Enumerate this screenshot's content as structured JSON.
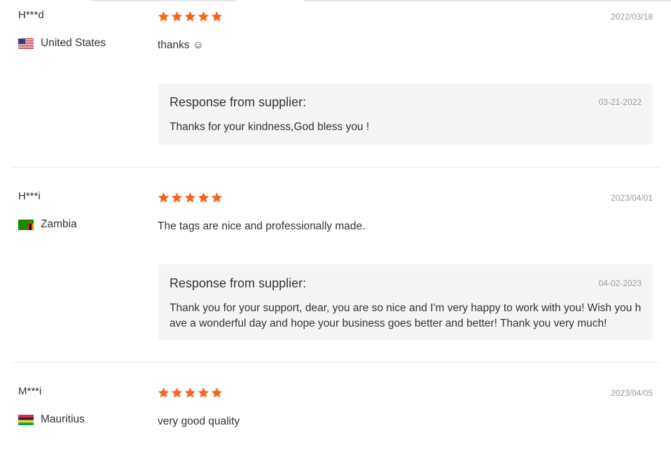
{
  "reviews": [
    {
      "reviewer": "H***d",
      "country": "United States",
      "flag": "us-flag",
      "rating": 5,
      "date": "2022/03/18",
      "text": "thanks ☺",
      "response": {
        "title": "Response from supplier:",
        "date": "03-21-2022",
        "text": "Thanks for your kindness,God bless you !"
      }
    },
    {
      "reviewer": "H***i",
      "country": "Zambia",
      "flag": "zambia-flag",
      "rating": 5,
      "date": "2023/04/01",
      "text": "The tags are nice and professionally made.",
      "response": {
        "title": "Response from supplier:",
        "date": "04-02-2023",
        "text": "Thank you for your support, dear, you are so nice and I'm very happy to work with you! Wish you have a wonderful day and hope your business goes better and better! Thank you very much!"
      }
    },
    {
      "reviewer": "M***i",
      "country": "Mauritius",
      "flag": "mauritius-flag",
      "rating": 5,
      "date": "2023/04/05",
      "text": "very good quality"
    }
  ],
  "colors": {
    "star": "#f7651c",
    "response_bg": "#f5f5f5",
    "date": "#999999",
    "text": "#333333"
  },
  "icons": {
    "star": "star-icon"
  }
}
